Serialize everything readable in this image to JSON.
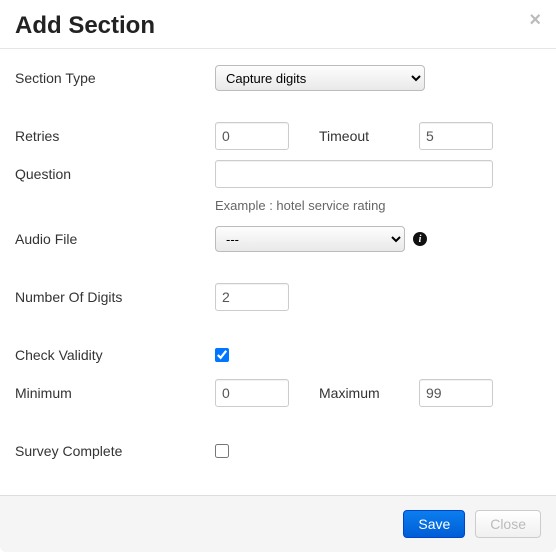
{
  "title": "Add Section",
  "close_glyph": "×",
  "labels": {
    "section_type": "Section Type",
    "retries": "Retries",
    "timeout": "Timeout",
    "question": "Question",
    "audio_file": "Audio File",
    "number_of_digits": "Number Of Digits",
    "check_validity": "Check Validity",
    "minimum": "Minimum",
    "maximum": "Maximum",
    "survey_complete": "Survey Complete"
  },
  "values": {
    "section_type": "Capture digits",
    "retries": "0",
    "timeout": "5",
    "question": "",
    "audio_file": "---",
    "number_of_digits": "2",
    "check_validity": true,
    "minimum": "0",
    "maximum": "99",
    "survey_complete": false
  },
  "help": {
    "question_example": "Example : hotel service rating"
  },
  "info_icon_glyph": "i",
  "footer": {
    "save": "Save",
    "close": "Close"
  }
}
